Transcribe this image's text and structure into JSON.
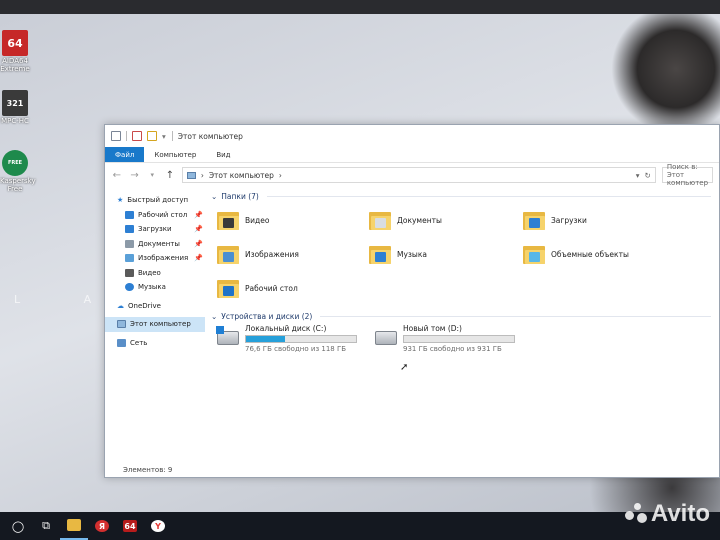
{
  "desktop": {
    "icons": [
      {
        "label": "AIDA64\nExtreme",
        "glyph": "64",
        "color": "#c62828"
      },
      {
        "label": "MPC-HC",
        "glyph": "321",
        "color": "#3a3a3a"
      },
      {
        "label": "Kaspersky\nFree",
        "glyph": "FREE",
        "color": "#1e8a4c"
      }
    ],
    "wallpaper_text": "L A C"
  },
  "window": {
    "title": "Этот компьютер",
    "ribbon_tabs": [
      "Файл",
      "Компьютер",
      "Вид"
    ],
    "address_path": "Этот компьютер",
    "search_placeholder": "Поиск в: Этот компьютер",
    "status": "Элементов: 9"
  },
  "nav_pane": {
    "quick_access": "Быстрый доступ",
    "pinned": [
      {
        "label": "Рабочий стол",
        "pinned": true,
        "color": "#2d7fd3"
      },
      {
        "label": "Загрузки",
        "pinned": true,
        "color": "#2d7fd3"
      },
      {
        "label": "Документы",
        "pinned": true,
        "color": "#8c9aa8"
      },
      {
        "label": "Изображения",
        "pinned": true,
        "color": "#5aa0d8"
      },
      {
        "label": "Видео",
        "pinned": false,
        "color": "#5a5a5a"
      },
      {
        "label": "Музыка",
        "pinned": false,
        "color": "#2d7fd3"
      }
    ],
    "onedrive": "OneDrive",
    "this_pc": "Этот компьютер",
    "network": "Сеть"
  },
  "folders_group": {
    "header": "Папки (7)",
    "items": [
      {
        "label": "Видео",
        "badge_color": "#3a3a3a"
      },
      {
        "label": "Документы",
        "badge_color": "#d8dde3"
      },
      {
        "label": "Загрузки",
        "badge_color": "#2d7fd3"
      },
      {
        "label": "Изображения",
        "badge_color": "#4b8fd1"
      },
      {
        "label": "Музыка",
        "badge_color": "#2d7fd3"
      },
      {
        "label": "Объемные объекты",
        "badge_color": "#58b7e8"
      },
      {
        "label": "Рабочий стол",
        "badge_color": "#1f73c8"
      }
    ]
  },
  "drives_group": {
    "header": "Устройства и диски (2)",
    "items": [
      {
        "name": "Локальный диск (C:)",
        "free_text": "76,6 ГБ свободно из 118 ГБ",
        "used_fraction": 0.35,
        "system": true
      },
      {
        "name": "Новый том (D:)",
        "free_text": "931 ГБ свободно из 931 ГБ",
        "used_fraction": 0.0,
        "system": false
      }
    ]
  },
  "taskbar": {
    "items": [
      {
        "name": "search",
        "glyph": "◯"
      },
      {
        "name": "task-view",
        "glyph": "⧉"
      },
      {
        "name": "explorer",
        "glyph": "",
        "color": "#e8b842",
        "active": true
      },
      {
        "name": "yandex",
        "glyph": "Я",
        "color": "#d32f2f"
      },
      {
        "name": "aida64",
        "glyph": "64",
        "color": "#b71c1c"
      },
      {
        "name": "yandex-browser",
        "glyph": "Y",
        "color": "#e53935"
      }
    ]
  },
  "watermark": "Avito"
}
